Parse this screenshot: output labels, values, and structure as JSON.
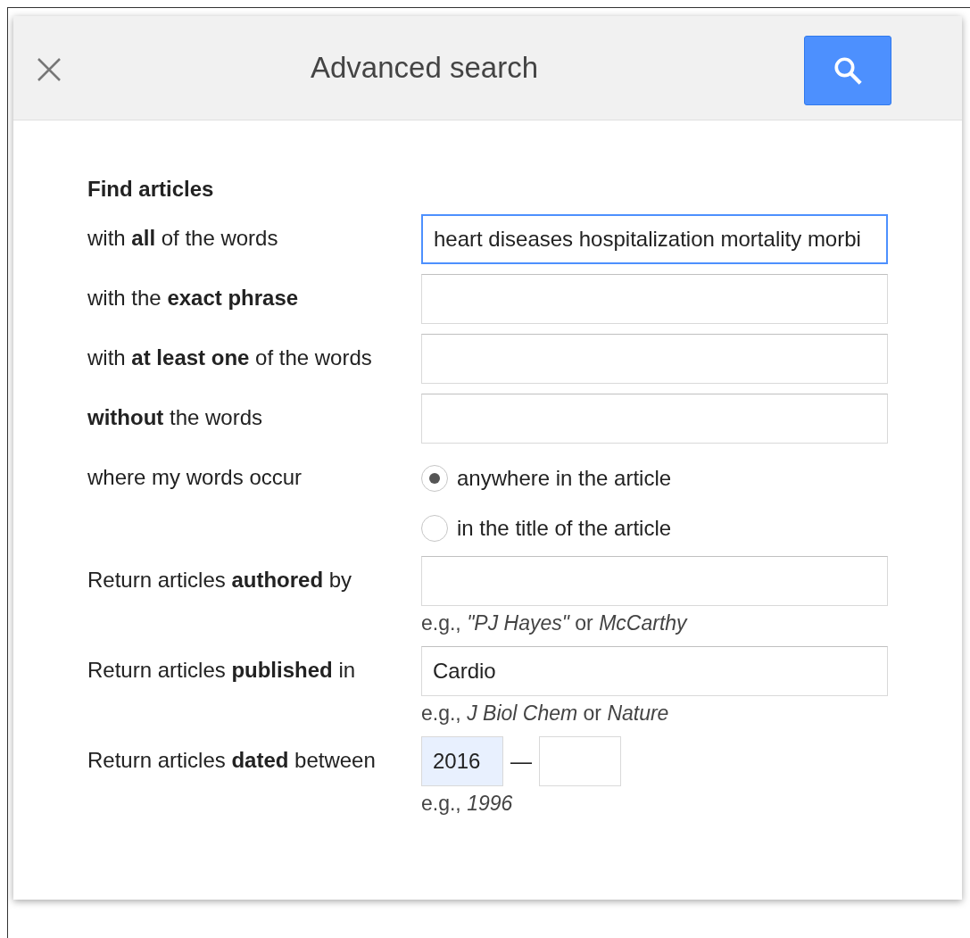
{
  "header": {
    "title": "Advanced search"
  },
  "section_title": "Find articles",
  "rows": [
    {
      "kind": "text",
      "label": "with **all** of the words",
      "value": "heart diseases hospitalization mortality morbi",
      "focused": true
    },
    {
      "kind": "text",
      "label": "with the **exact phrase**",
      "focused": false
    },
    {
      "kind": "text",
      "label": "with **at least one** of the words",
      "focused": false
    },
    {
      "kind": "text",
      "label": "**without** the words",
      "focused": false
    },
    {
      "kind": "radio",
      "label": "where my words occur",
      "options": [
        {
          "label": "anywhere in the article",
          "selected": true
        },
        {
          "label": "in the title of the article",
          "selected": false
        }
      ]
    },
    {
      "kind": "text",
      "label": "Return articles **authored** by",
      "hint": "e.g., *\"PJ Hayes\"* or *McCarthy*",
      "focused": false
    },
    {
      "kind": "text",
      "label": "Return articles **published** in",
      "value": "Cardio",
      "hint": "e.g., *J Biol Chem* or *Nature*",
      "focused": false
    },
    {
      "kind": "date",
      "label": "Return articles **dated** between",
      "from": "2016",
      "from_autofilled": true,
      "separator": "—",
      "hint": "e.g., *1996*"
    }
  ]
}
